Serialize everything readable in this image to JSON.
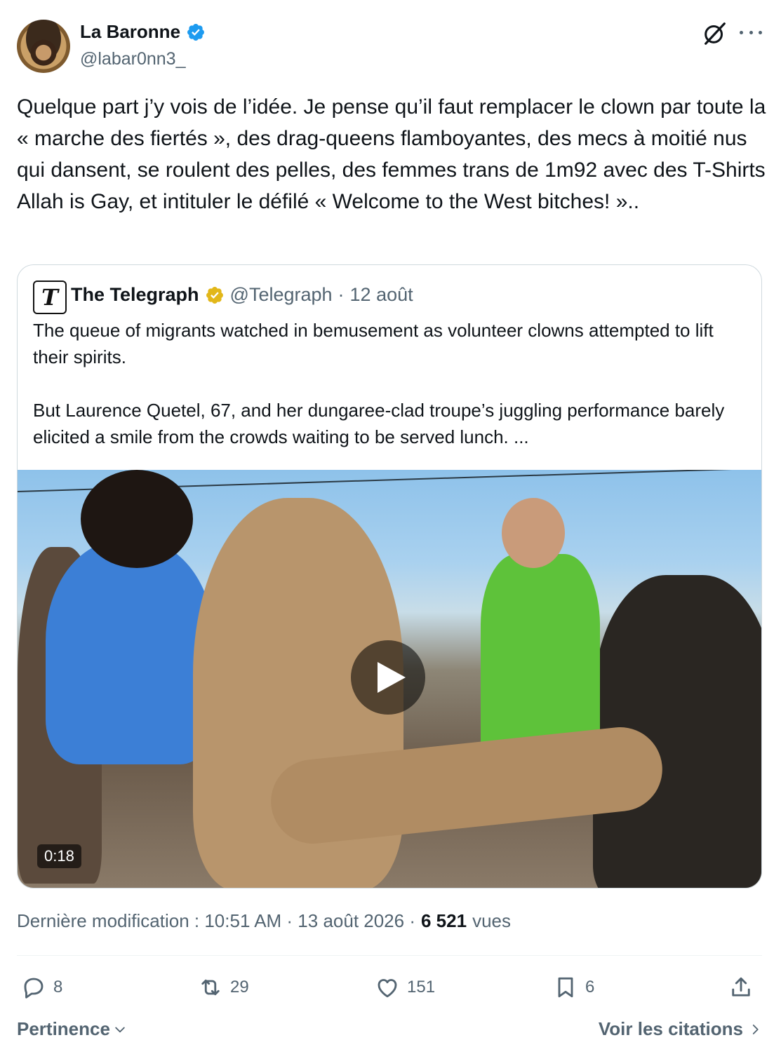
{
  "author": {
    "name": "La Baronne",
    "handle": "@labar0nn3_"
  },
  "tweet": {
    "text": "Quelque part j’y vois de l’idée. Je pense qu’il faut remplacer le clown par toute la « marche des fiertés », des drag-queens flamboyantes, des mecs à moitié nus qui dansent, se roulent des pelles, des femmes trans de 1m92 avec des T-Shirts Allah is Gay, et intituler le défilé « Welcome to the West bitches! ».."
  },
  "quote": {
    "name": "The Telegraph",
    "handle": "@Telegraph",
    "dot": "·",
    "date": "12 août",
    "text": "The queue of migrants watched in bemusement as volunteer clowns attempted to lift their spirits.\n\nBut Laurence Quetel, 67, and her dungaree-clad troupe’s juggling performance barely elicited a smile from the crowds waiting to be served lunch. ...",
    "video_duration": "0:18"
  },
  "meta": {
    "modified_label": "Dernière modification : 10:51 AM · 13 août 2026 ·",
    "views_count": "6 521",
    "views_label": "vues"
  },
  "actions": {
    "replies": "8",
    "reposts": "29",
    "likes": "151",
    "bookmarks": "6"
  },
  "footer": {
    "sort_label": "Pertinence",
    "quotes_link": "Voir les citations"
  },
  "icons": {
    "verified": "verified-badge-icon",
    "grok": "grok-icon",
    "more": "more-icon",
    "reply": "reply-icon",
    "repost": "repost-icon",
    "like": "like-icon",
    "bookmark": "bookmark-icon",
    "share": "share-icon"
  },
  "colors": {
    "verified_blue": "#1d9bf0",
    "verified_gold": "#e2b719",
    "muted_text": "#536471",
    "primary_text": "#0f1419",
    "border": "#cfd9de"
  }
}
